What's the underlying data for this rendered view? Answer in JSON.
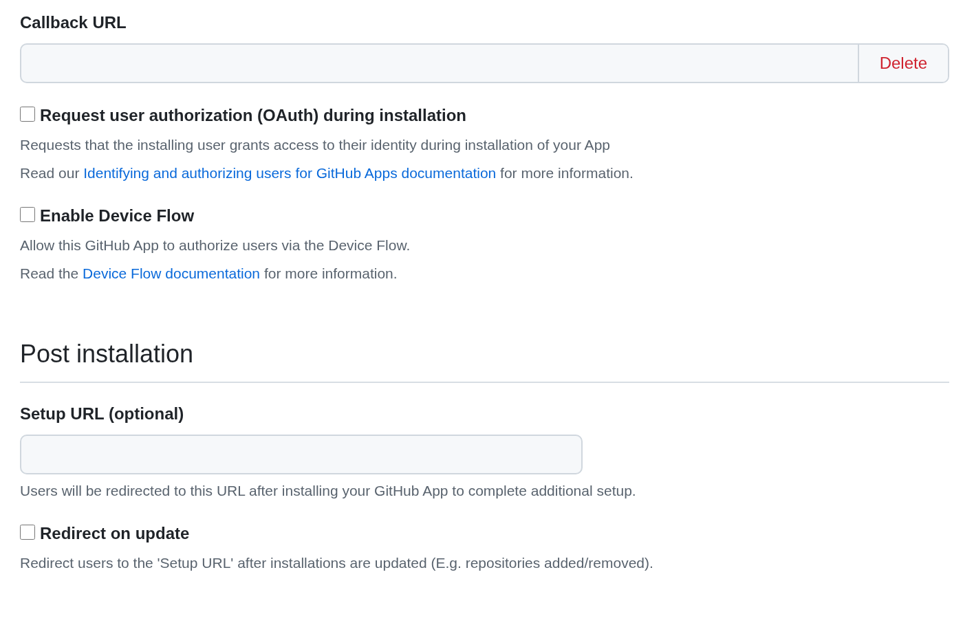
{
  "callback_url": {
    "label": "Callback URL",
    "button": "Delete"
  },
  "auth_options": [
    {
      "label": "Request user authorization (OAuth) during installation",
      "checked": false,
      "notes": [
        {
          "kind": "text",
          "text": "Requests that the installing user grants access to their identity during installation of your App"
        },
        {
          "kind": "link",
          "before": "Read our ",
          "link": "Identifying and authorizing users for GitHub Apps documentation",
          "after": " for more information."
        }
      ]
    },
    {
      "label": "Enable Device Flow",
      "checked": false,
      "notes": [
        {
          "kind": "text",
          "text": "Allow this GitHub App to authorize users via the Device Flow."
        },
        {
          "kind": "link",
          "before": "Read the ",
          "link": "Device Flow documentation",
          "after": " for more information."
        }
      ]
    }
  ],
  "post_installation": {
    "heading": "Post installation",
    "setup_url": {
      "label": "Setup URL (optional)",
      "hint": "Users will be redirected to this URL after installing your GitHub App to complete additional setup."
    },
    "options": [
      {
        "label": "Redirect on update",
        "checked": false,
        "notes": [
          {
            "kind": "text",
            "text": "Redirect users to the 'Setup URL' after installations are updated (E.g. repositories added/removed)."
          }
        ]
      }
    ]
  }
}
